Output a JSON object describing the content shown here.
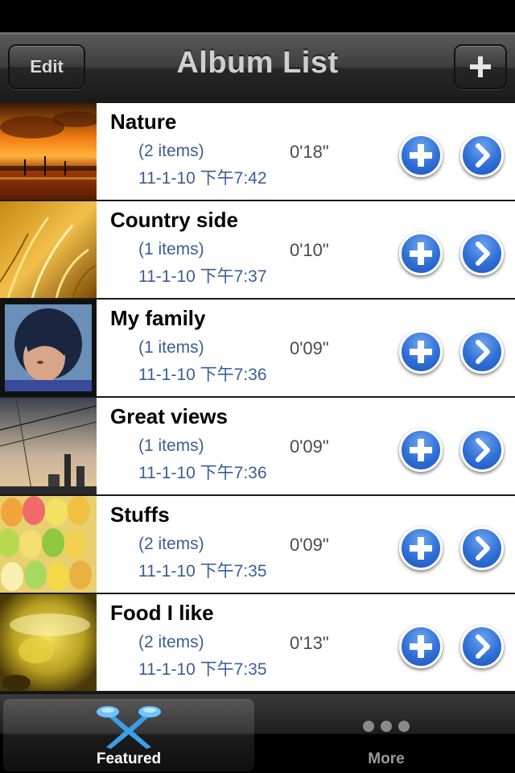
{
  "nav": {
    "title": "Album List",
    "edit_label": "Edit",
    "add_icon": "plus-icon"
  },
  "albums": [
    {
      "title": "Nature",
      "count": "(2 items)",
      "date": "11-1-10  下午7:42",
      "duration": "0'18\"",
      "thumb": "sunset-harbor"
    },
    {
      "title": "Country side",
      "count": "(1 items)",
      "date": "11-1-10  下午7:37",
      "duration": "0'10\"",
      "thumb": "golden-grass"
    },
    {
      "title": "My family",
      "count": "(1 items)",
      "date": "11-1-10  下午7:36",
      "duration": "0'09\"",
      "thumb": "portrait"
    },
    {
      "title": "Great views",
      "count": "(1 items)",
      "date": "11-1-10  下午7:36",
      "duration": "0'09\"",
      "thumb": "city-dusk"
    },
    {
      "title": "Stuffs",
      "count": "(2 items)",
      "date": "11-1-10  下午7:35",
      "duration": "0'09\"",
      "thumb": "macarons"
    },
    {
      "title": "Food I like",
      "count": "(2 items)",
      "date": "11-1-10  下午7:35",
      "duration": "0'13\"",
      "thumb": "yellow-drink"
    }
  ],
  "tabs": [
    {
      "label": "Featured",
      "icon": "featured-x-icon",
      "selected": true
    },
    {
      "label": "More",
      "icon": "more-dots-icon",
      "selected": false
    }
  ],
  "colors": {
    "accent_blue": "#2f6fd6",
    "detail_text": "#3b5e95"
  }
}
